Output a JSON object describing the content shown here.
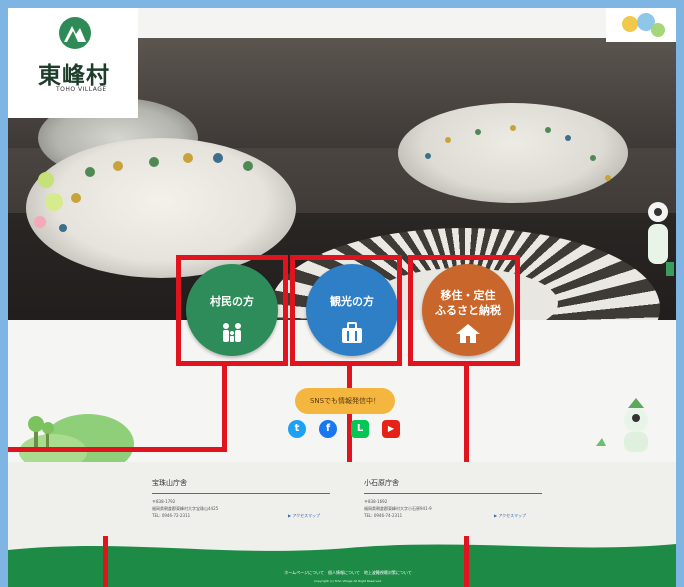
{
  "logo": {
    "title": "東峰村",
    "subtitle": "TOHO VILLAGE"
  },
  "nav_buttons": [
    {
      "label": "村民の方",
      "icon": "family-icon",
      "color": "#2e8c5a"
    },
    {
      "label": "観光の方",
      "icon": "luggage-icon",
      "color": "#2f7fc6"
    },
    {
      "label": "移住・定住\nふるさと納税",
      "icon": "house-icon",
      "color": "#c8662b"
    }
  ],
  "sns": {
    "bubble": "SNSでも情報発信中！",
    "icons": [
      {
        "name": "twitter-icon",
        "color": "#1da1f2",
        "glyph": "t"
      },
      {
        "name": "facebook-icon",
        "color": "#1877f2",
        "glyph": "f"
      },
      {
        "name": "line-icon",
        "color": "#06c755",
        "glyph": "L"
      },
      {
        "name": "youtube-icon",
        "color": "#e62117",
        "glyph": "▶"
      }
    ]
  },
  "offices": [
    {
      "title": "宝珠山庁舎",
      "zip": "〒838-1792",
      "address": "福岡県朝倉郡東峰村大字宝珠山4425",
      "tel": "TEL: 0946-72-2311",
      "access": "▶ アクセスマップ"
    },
    {
      "title": "小石原庁舎",
      "zip": "〒838-1692",
      "address": "福岡県朝倉郡東峰村大字小石原941-9",
      "tel": "TEL: 0946-74-2311",
      "access": "▶ アクセスマップ"
    }
  ],
  "footer": {
    "links": "ホームページについて　個人情報について　地上波難視聴対策について",
    "copyright": "Copyright (c) Toho Village All Right Reserved."
  },
  "colors": {
    "highlight": "#e0141e",
    "brand_green": "#1d8a45"
  }
}
